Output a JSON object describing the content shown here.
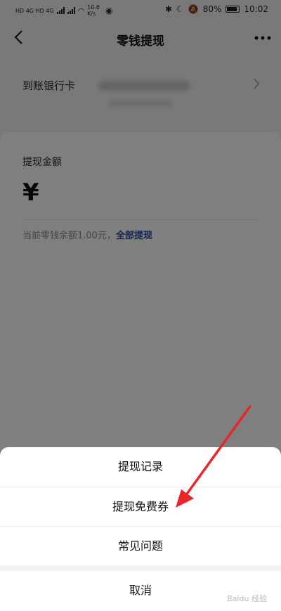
{
  "status_bar": {
    "network_left": "HD 4G HD 4G",
    "speed": "10.6 K/s",
    "battery": "80%",
    "time": "10:02"
  },
  "nav": {
    "title": "零钱提现",
    "back_icon": "chevron-left-icon",
    "more_icon": "more-dots-icon"
  },
  "bank": {
    "label": "到账银行卡",
    "chevron_icon": "chevron-right-icon"
  },
  "amount": {
    "label": "提现金额",
    "currency": "¥",
    "balance_text": "当前零钱余额1.00元，",
    "withdraw_all": "全部提现"
  },
  "action_sheet": {
    "items": [
      {
        "label": "提现记录"
      },
      {
        "label": "提现免费券"
      },
      {
        "label": "常见问题"
      }
    ],
    "cancel": "取消"
  },
  "annotation": {
    "color": "#e8262a"
  },
  "watermark": "Baidu 经验"
}
